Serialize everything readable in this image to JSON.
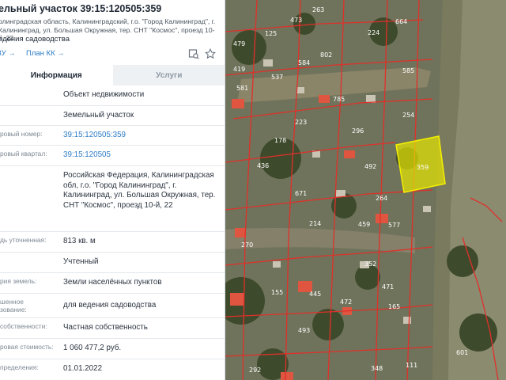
{
  "header": {
    "title": "ельный участок 39:15:120505:359",
    "address": "олинградская область, Калининградский, г.о. \"Город Калининград\", г. Калининград, ул. Большая Окружная, тер. СНТ \"Космос\", проезд 10-й, 22",
    "purpose": "едения садоводства",
    "link_zu": "ЗУ →",
    "link_kk": "План КК →"
  },
  "tabs": [
    {
      "label": "Информация",
      "active": true
    },
    {
      "label": "Услуги",
      "active": false
    }
  ],
  "rows": [
    {
      "label": "",
      "value": "Объект недвижимости"
    },
    {
      "label": "",
      "value": "Земельный участок"
    },
    {
      "label": "ровый номер:",
      "value": "39:15:120505:359"
    },
    {
      "label": "ровый квартал:",
      "value": "39:15:120505"
    },
    {
      "label": "",
      "value": "Российская Федерация, Калининградская обл, г.о. \"Город Калининград\", г. Калининград, ул. Большая Окружная, тер. СНТ \"Космос\", проезд 10-й, 22"
    },
    {
      "label": "дь уточненная:",
      "value": "813 кв. м"
    },
    {
      "label": "",
      "value": "Учтенный"
    },
    {
      "label": "рия земель:",
      "value": "Земли населённых пунктов"
    },
    {
      "label": "шенное\nзование:",
      "value": "для ведения садоводства"
    },
    {
      "label": "собственности:",
      "value": "Частная собственность"
    },
    {
      "label": "ровая стоимость:",
      "value": "1 060 477,2 руб."
    },
    {
      "label": "пределения:",
      "value": "01.01.2022"
    }
  ],
  "icons": {
    "map_icon": "map-pin-icon",
    "star_icon": "star-icon"
  },
  "colors": {
    "link": "#2d7cc6",
    "selected_parcel": "#e6e600",
    "parcel_border": "#e0302a"
  },
  "map": {
    "parcel_labels": [
      "263",
      "664",
      "479",
      "125",
      "473",
      "224",
      "419",
      "584",
      "802",
      "537",
      "585",
      "581",
      "785",
      "223",
      "296",
      "254",
      "178",
      "492",
      "359",
      "436",
      "671",
      "264",
      "214",
      "459",
      "577",
      "270",
      "352",
      "471",
      "155",
      "445",
      "472",
      "493",
      "165",
      "111",
      "348",
      "601",
      "292"
    ],
    "selected_label": "359"
  }
}
